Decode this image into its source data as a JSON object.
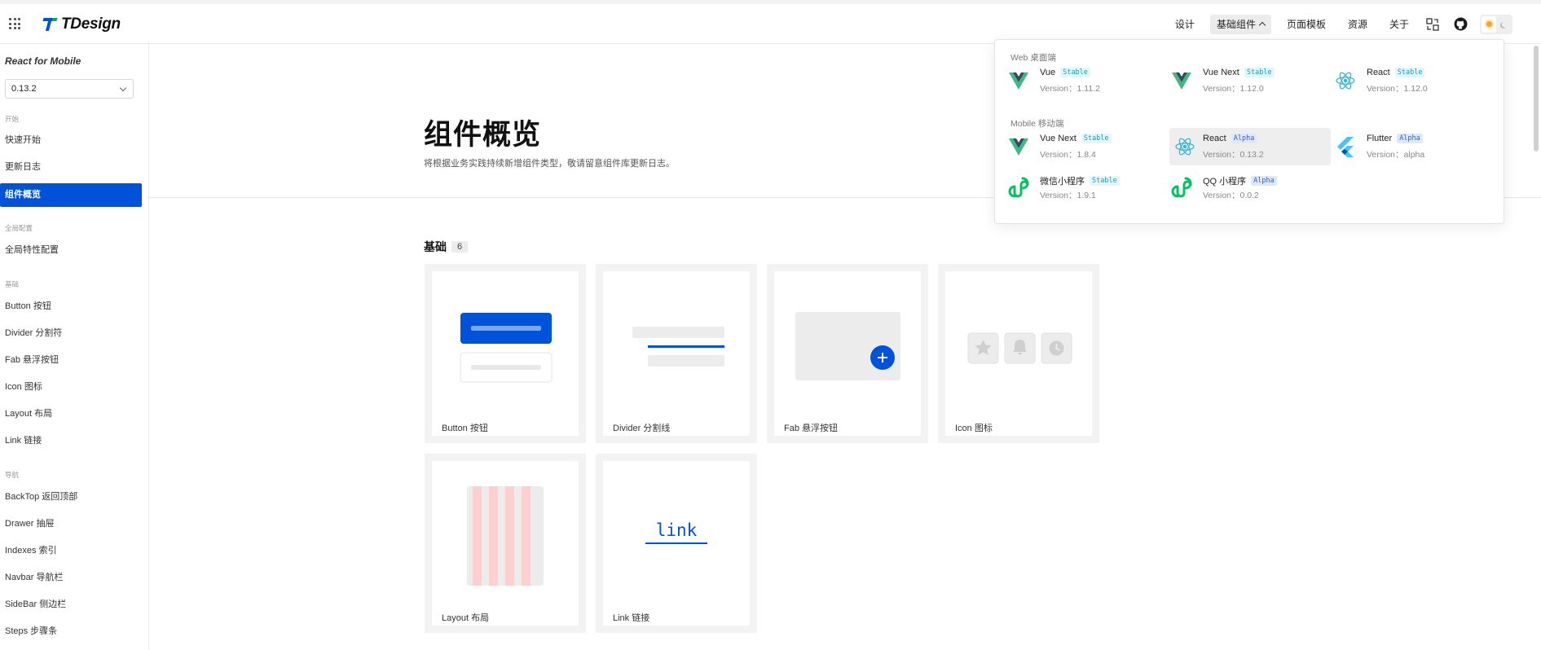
{
  "header": {
    "logo_text": "TDesign",
    "nav": [
      {
        "label": "设计",
        "active": false
      },
      {
        "label": "基础组件",
        "active": true
      },
      {
        "label": "页面模板",
        "active": false
      },
      {
        "label": "资源",
        "active": false
      },
      {
        "label": "关于",
        "active": false
      }
    ],
    "icons": [
      "translate-icon",
      "github-icon",
      "sun-icon",
      "moon-icon"
    ]
  },
  "sidebar": {
    "title": "React for Mobile",
    "version": "0.13.2",
    "groups": [
      {
        "label": "开始",
        "items": [
          "快速开始",
          "更新日志",
          "组件概览"
        ]
      },
      {
        "label": "全局配置",
        "items": [
          "全局特性配置"
        ]
      },
      {
        "label": "基础",
        "items": [
          "Button 按钮",
          "Divider 分割符",
          "Fab 悬浮按钮",
          "Icon 图标",
          "Layout 布局",
          "Link 链接"
        ]
      },
      {
        "label": "导航",
        "items": [
          "BackTop 返回顶部",
          "Drawer 抽屉",
          "Indexes 索引",
          "Navbar 导航栏",
          "SideBar 侧边栏",
          "Steps 步骤条"
        ]
      }
    ],
    "active_item": "组件概览"
  },
  "main": {
    "title": "组件概览",
    "subtitle": "将根据业务实践持续新增组件类型，敬请留意组件库更新日志。",
    "section": {
      "title": "基础",
      "count": "6"
    },
    "cards": [
      "Button 按钮",
      "Divider 分割线",
      "Fab 悬浮按钮",
      "Icon 图标",
      "Layout 布局",
      "Link 链接"
    ],
    "link_demo_text": "link"
  },
  "dropdown": {
    "web_group": "Web 桌面端",
    "mobile_group": "Mobile 移动端",
    "web": [
      {
        "name": "Vue",
        "badge": "Stable",
        "version": "Version：1.11.2",
        "icon": "vue-icon"
      },
      {
        "name": "Vue Next",
        "badge": "Stable",
        "version": "Version：1.12.0",
        "icon": "vue-icon"
      },
      {
        "name": "React",
        "badge": "Stable",
        "version": "Version：1.12.0",
        "icon": "react-icon"
      }
    ],
    "mobile": [
      {
        "name": "Vue Next",
        "badge": "Stable",
        "version": "Version：1.8.4",
        "icon": "vue-icon"
      },
      {
        "name": "React",
        "badge": "Alpha",
        "version": "Version：0.13.2",
        "icon": "react-icon",
        "active": true
      },
      {
        "name": "Flutter",
        "badge": "Alpha",
        "version": "Version：alpha",
        "icon": "flutter-icon"
      },
      {
        "name": "微信小程序",
        "badge": "Stable",
        "version": "Version：1.9.1",
        "icon": "miniprogram-icon"
      },
      {
        "name": "QQ 小程序",
        "badge": "Alpha",
        "version": "Version：0.0.2",
        "icon": "miniprogram-icon"
      }
    ]
  },
  "colors": {
    "brand": "#0052d9",
    "active_bg": "#eeeeee"
  }
}
